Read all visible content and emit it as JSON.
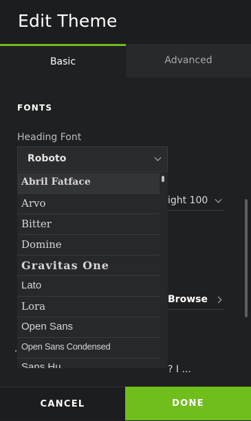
{
  "header": {
    "title": "Edit Theme"
  },
  "tabs": [
    {
      "label": "Basic",
      "active": true
    },
    {
      "label": "Advanced",
      "active": false
    }
  ],
  "fonts": {
    "section_title": "FONTS",
    "heading_font_label": "Heading Font",
    "heading_font_value": "Roboto",
    "options": [
      "Abril Fatface",
      "Arvo",
      "Bitter",
      "Domine",
      "Gravitas One",
      "Lato",
      "Lora",
      "Open Sans",
      "Open Sans Condensed",
      "Sans Hu..."
    ],
    "highlighted_option": "Abril Fatface"
  },
  "background": {
    "weight_value": "ight 100",
    "browse_label": "Browse",
    "partial_text": "? I ..."
  },
  "footer": {
    "cancel_label": "CANCEL",
    "done_label": "DONE"
  },
  "colors": {
    "accent": "#6fbe1c",
    "background": "#1f2022",
    "panel": "#27282a"
  }
}
